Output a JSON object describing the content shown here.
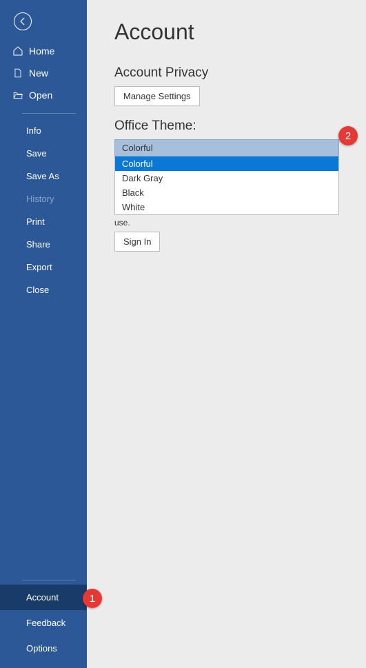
{
  "sidebar": {
    "home": "Home",
    "new": "New",
    "open": "Open",
    "items": [
      {
        "label": "Info"
      },
      {
        "label": "Save"
      },
      {
        "label": "Save As"
      },
      {
        "label": "History"
      },
      {
        "label": "Print"
      },
      {
        "label": "Share"
      },
      {
        "label": "Export"
      },
      {
        "label": "Close"
      }
    ],
    "bottom": [
      {
        "label": "Account"
      },
      {
        "label": "Feedback"
      },
      {
        "label": "Options"
      }
    ]
  },
  "page": {
    "title": "Account",
    "privacy_heading": "Account Privacy",
    "manage_settings": "Manage Settings",
    "theme_heading": "Office Theme:",
    "theme_selected": "Colorful",
    "theme_options": {
      "opt0": "Colorful",
      "opt1": "Dark Gray",
      "opt2": "Black",
      "opt3": "White"
    },
    "connected_trailing": "use.",
    "sign_in": "Sign In"
  },
  "annotations": {
    "a1": "1",
    "a2": "2"
  }
}
